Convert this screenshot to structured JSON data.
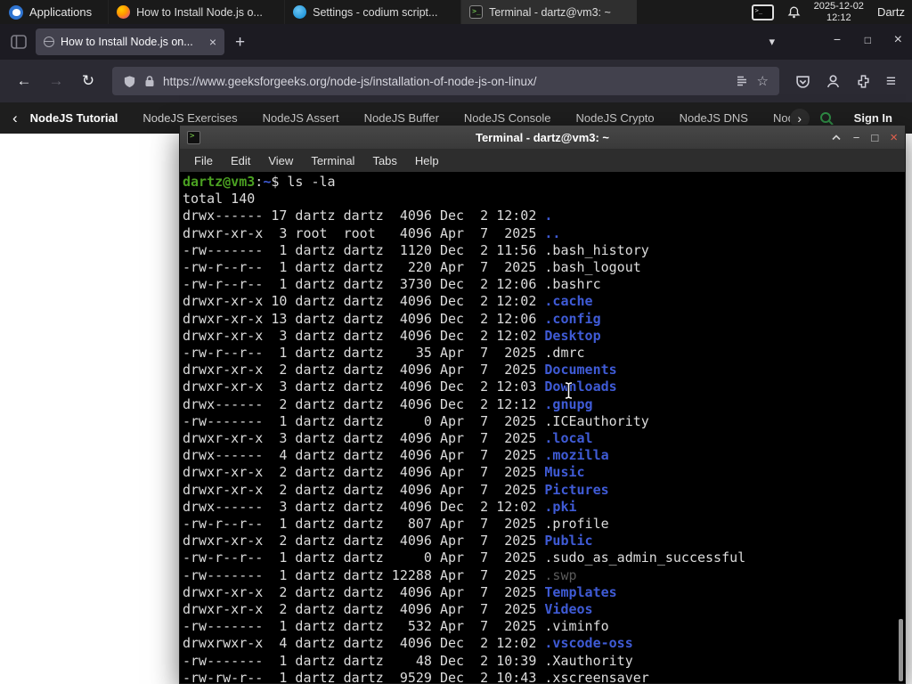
{
  "colors": {
    "gfg_green": "#2f8d46"
  },
  "panel": {
    "applications_label": "Applications",
    "tasks": [
      {
        "icon": "firefox",
        "label": "How to Install Node.js o...",
        "active": false
      },
      {
        "icon": "codium",
        "label": "Settings - codium script...",
        "active": false
      },
      {
        "icon": "terminal",
        "label": "Terminal - dartz@vm3: ~",
        "active": true
      }
    ],
    "clock_date": "2025-12-02",
    "clock_time": "12:12",
    "user": "Dartz"
  },
  "browser": {
    "tab_title": "How to Install Node.js on...",
    "tab_close_glyph": "×",
    "new_tab_glyph": "+",
    "list_tabs_glyph": "▾",
    "window_controls": {
      "minimize": "−",
      "restore": "□",
      "close": "×"
    },
    "back_glyph": "←",
    "forward_glyph": "→",
    "reload_glyph": "↻",
    "url": "https://www.geeksforgeeks.org/node-js/installation-of-node-js-on-linux/",
    "star_glyph": "☆",
    "menu_glyph": "≡"
  },
  "site_nav": {
    "scroll_left_glyph": "‹",
    "scroll_right_glyph": "›",
    "items": [
      {
        "label": "NodeJS Tutorial",
        "active": true
      },
      {
        "label": "NodeJS Exercises",
        "active": false
      },
      {
        "label": "NodeJS Assert",
        "active": false
      },
      {
        "label": "NodeJS Buffer",
        "active": false
      },
      {
        "label": "NodeJS Console",
        "active": false
      },
      {
        "label": "NodeJS Crypto",
        "active": false
      },
      {
        "label": "NodeJS DNS",
        "active": false
      },
      {
        "label": "Node",
        "active": false
      }
    ],
    "sign_in_label": "Sign In"
  },
  "terminal": {
    "title": "Terminal - dartz@vm3: ~",
    "menu": [
      "File",
      "Edit",
      "View",
      "Terminal",
      "Tabs",
      "Help"
    ],
    "controls": {
      "minimize": "−",
      "maximize": "□",
      "close": "×"
    },
    "prompt": {
      "user_host": "dartz@vm3",
      "separator": ":",
      "path": "~",
      "symbol": "$",
      "command": "ls -la"
    },
    "total_line": "total 140",
    "listing": [
      {
        "meta": "drwx------ 17 dartz dartz  4096 Dec  2 12:02 ",
        "name": ".",
        "type": "dir"
      },
      {
        "meta": "drwxr-xr-x  3 root  root   4096 Apr  7  2025 ",
        "name": "..",
        "type": "dir"
      },
      {
        "meta": "-rw-------  1 dartz dartz  1120 Dec  2 11:56 ",
        "name": ".bash_history",
        "type": "file"
      },
      {
        "meta": "-rw-r--r--  1 dartz dartz   220 Apr  7  2025 ",
        "name": ".bash_logout",
        "type": "file"
      },
      {
        "meta": "-rw-r--r--  1 dartz dartz  3730 Dec  2 12:06 ",
        "name": ".bashrc",
        "type": "file"
      },
      {
        "meta": "drwxr-xr-x 10 dartz dartz  4096 Dec  2 12:02 ",
        "name": ".cache",
        "type": "dir"
      },
      {
        "meta": "drwxr-xr-x 13 dartz dartz  4096 Dec  2 12:06 ",
        "name": ".config",
        "type": "dir"
      },
      {
        "meta": "drwxr-xr-x  3 dartz dartz  4096 Dec  2 12:02 ",
        "name": "Desktop",
        "type": "dir"
      },
      {
        "meta": "-rw-r--r--  1 dartz dartz    35 Apr  7  2025 ",
        "name": ".dmrc",
        "type": "file"
      },
      {
        "meta": "drwxr-xr-x  2 dartz dartz  4096 Apr  7  2025 ",
        "name": "Documents",
        "type": "dir"
      },
      {
        "meta": "drwxr-xr-x  3 dartz dartz  4096 Dec  2 12:03 ",
        "name": "Downloads",
        "type": "dir"
      },
      {
        "meta": "drwx------  2 dartz dartz  4096 Dec  2 12:12 ",
        "name": ".gnupg",
        "type": "dir"
      },
      {
        "meta": "-rw-------  1 dartz dartz     0 Apr  7  2025 ",
        "name": ".ICEauthority",
        "type": "file"
      },
      {
        "meta": "drwxr-xr-x  3 dartz dartz  4096 Apr  7  2025 ",
        "name": ".local",
        "type": "dir"
      },
      {
        "meta": "drwx------  4 dartz dartz  4096 Apr  7  2025 ",
        "name": ".mozilla",
        "type": "dir"
      },
      {
        "meta": "drwxr-xr-x  2 dartz dartz  4096 Apr  7  2025 ",
        "name": "Music",
        "type": "dir"
      },
      {
        "meta": "drwxr-xr-x  2 dartz dartz  4096 Apr  7  2025 ",
        "name": "Pictures",
        "type": "dir"
      },
      {
        "meta": "drwx------  3 dartz dartz  4096 Dec  2 12:02 ",
        "name": ".pki",
        "type": "dir"
      },
      {
        "meta": "-rw-r--r--  1 dartz dartz   807 Apr  7  2025 ",
        "name": ".profile",
        "type": "file"
      },
      {
        "meta": "drwxr-xr-x  2 dartz dartz  4096 Apr  7  2025 ",
        "name": "Public",
        "type": "dir"
      },
      {
        "meta": "-rw-r--r--  1 dartz dartz     0 Apr  7  2025 ",
        "name": ".sudo_as_admin_successful",
        "type": "file"
      },
      {
        "meta": "-rw-------  1 dartz dartz 12288 Apr  7  2025 ",
        "name": ".swp",
        "type": "dim"
      },
      {
        "meta": "drwxr-xr-x  2 dartz dartz  4096 Apr  7  2025 ",
        "name": "Templates",
        "type": "dir"
      },
      {
        "meta": "drwxr-xr-x  2 dartz dartz  4096 Apr  7  2025 ",
        "name": "Videos",
        "type": "dir"
      },
      {
        "meta": "-rw-------  1 dartz dartz   532 Apr  7  2025 ",
        "name": ".viminfo",
        "type": "file"
      },
      {
        "meta": "drwxrwxr-x  4 dartz dartz  4096 Dec  2 12:02 ",
        "name": ".vscode-oss",
        "type": "dir"
      },
      {
        "meta": "-rw-------  1 dartz dartz    48 Dec  2 10:39 ",
        "name": ".Xauthority",
        "type": "file"
      },
      {
        "meta": "-rw-rw-r--  1 dartz dartz  9529 Dec  2 10:43 ",
        "name": ".xscreensaver",
        "type": "file"
      }
    ],
    "colors": {
      "background": "#000000",
      "foreground": "#dcdcdc",
      "prompt_green": "#4aa021",
      "dir_blue": "#3f5bd6",
      "dim": "#5a5a5a"
    }
  }
}
